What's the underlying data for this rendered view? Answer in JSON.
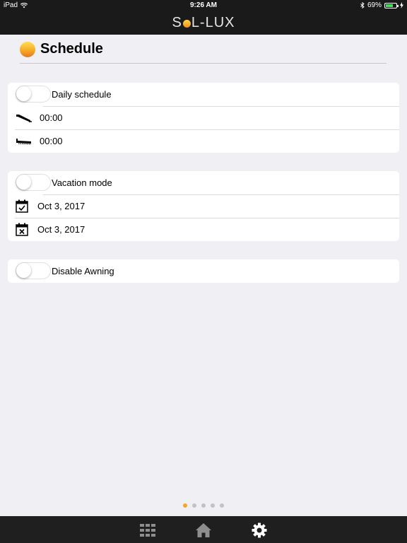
{
  "status_bar": {
    "device": "iPad",
    "time": "9:26 AM",
    "battery_percent": "69%",
    "battery_level": 0.69
  },
  "nav": {
    "logo_part1": "S",
    "logo_part2": "L-LUX"
  },
  "header": {
    "title": "Schedule",
    "icon": "sun-icon"
  },
  "daily_schedule": {
    "label": "Daily schedule",
    "enabled": false,
    "extend_time": "00:00",
    "retract_time": "00:00",
    "extend_icon": "awning-extend-icon",
    "retract_icon": "awning-retract-icon"
  },
  "vacation_mode": {
    "label": "Vacation mode",
    "enabled": false,
    "start_date": "Oct 3, 2017",
    "end_date": "Oct 3, 2017",
    "start_icon": "calendar-check-icon",
    "end_icon": "calendar-x-icon"
  },
  "disable_awning": {
    "label": "Disable Awning",
    "enabled": false
  },
  "pager": {
    "page_count": 5,
    "current_page": 1
  },
  "tab_bar": {
    "items": [
      "grid-icon",
      "home-icon",
      "gear-icon"
    ],
    "selected": "gear-icon"
  },
  "colors": {
    "accent": "#f5a623",
    "bar_background": "#1a1a1a",
    "page_background": "#efeff4",
    "battery_green": "#4cd964"
  }
}
